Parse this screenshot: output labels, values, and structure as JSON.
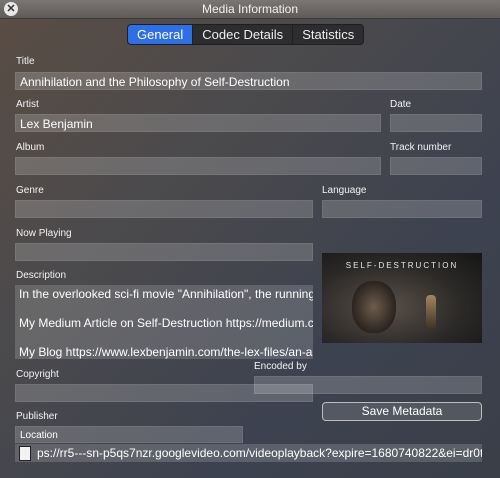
{
  "window": {
    "title": "Media Information"
  },
  "tabs": [
    {
      "label": "General"
    },
    {
      "label": "Codec Details"
    },
    {
      "label": "Statistics"
    }
  ],
  "fields": {
    "title": {
      "label": "Title",
      "value": "Annihilation and the Philosophy of Self-Destruction"
    },
    "artist": {
      "label": "Artist",
      "value": "Lex Benjamin"
    },
    "date": {
      "label": "Date",
      "value": ""
    },
    "album": {
      "label": "Album",
      "value": ""
    },
    "track_number": {
      "label": "Track number",
      "value": ""
    },
    "genre": {
      "label": "Genre",
      "value": ""
    },
    "language": {
      "label": "Language",
      "value": ""
    },
    "now_playing": {
      "label": "Now Playing",
      "value": ""
    },
    "description": {
      "label": "Description",
      "lines": [
        "In the overlooked sci-fi movie \"Annihilation\", the running",
        "My Medium Article on Self-Destruction https://medium.c",
        "My Blog https://www.lexbenjamin.com/the-lex-files/an-a"
      ]
    },
    "copyright": {
      "label": "Copyright",
      "value": ""
    },
    "encoded_by": {
      "label": "Encoded by",
      "value": ""
    },
    "publisher": {
      "label": "Publisher",
      "value": ""
    },
    "location": {
      "label": "Location",
      "value": "ps://rr5---sn-p5qs7nzr.googlevideo.com/videoplayback?expire=1680740822&ei=dr0t"
    }
  },
  "artwork": {
    "title": "SELF-DESTRUCTION"
  },
  "buttons": {
    "save": "Save Metadata"
  }
}
